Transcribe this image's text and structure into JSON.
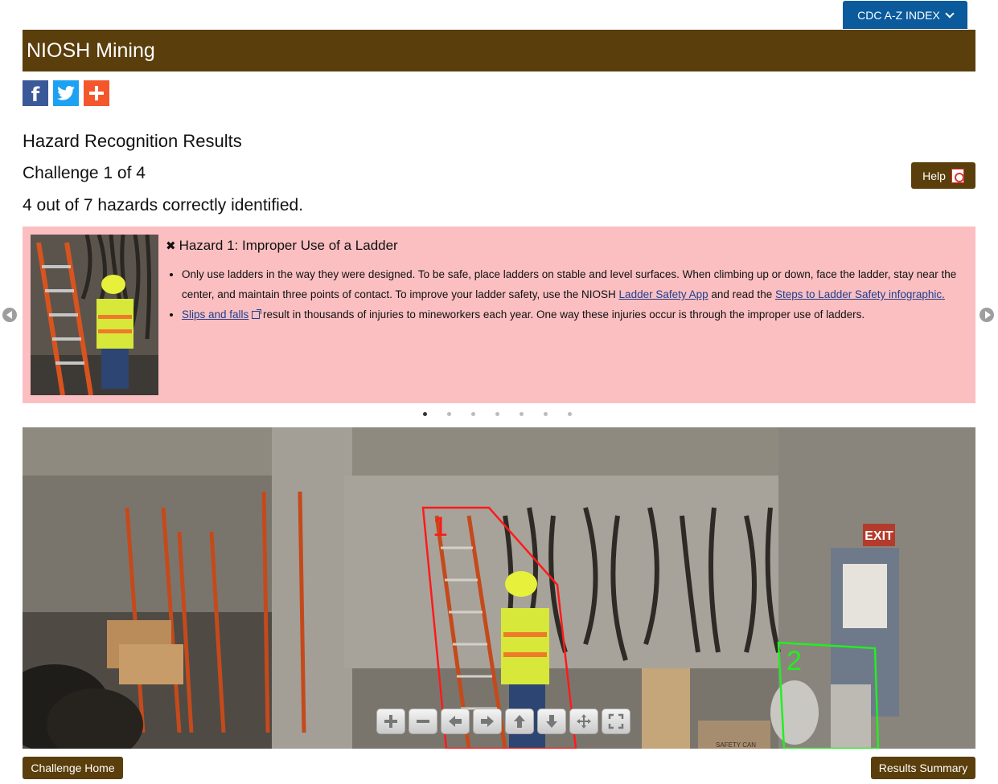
{
  "header": {
    "az_index_label": "CDC A-Z INDEX",
    "banner_title": "NIOSH Mining"
  },
  "social": {
    "facebook_glyph": "f",
    "twitter_icon": "twitter-bird-icon",
    "add_icon": "plus-icon"
  },
  "results": {
    "title": "Hazard Recognition Results",
    "challenge": "Challenge 1 of 4",
    "score": "4 out of 7 hazards correctly identified.",
    "help_label": "Help"
  },
  "hazard": {
    "status_glyph": "✖",
    "title": "Hazard 1: Improper Use of a Ladder",
    "bullet1_text": "Only use ladders in the way they were designed. To be safe, place ladders on stable and level surfaces. When climbing up or down, face the ladder, stay near the center, and maintain three points of contact. To improve your ladder safety, use the NIOSH ",
    "bullet1_link1": "Ladder Safety App",
    "bullet1_mid": " and read the ",
    "bullet1_link2": "Steps to Ladder Safety infographic.",
    "bullet2_link": "Slips and falls",
    "bullet2_text": " result in thousands of injuries to mineworkers each year. One way these injuries occur is through the improper use of ladders.",
    "card_color": "#fbbfc1"
  },
  "carousel": {
    "dot_count": 7,
    "active_index": 0
  },
  "scene": {
    "marker1": "1",
    "marker2": "2",
    "exit_sign": "EXIT",
    "box_label": "SAFETY CAN"
  },
  "zoom_controls": [
    "zoom-in-icon",
    "zoom-out-icon",
    "pan-left-icon",
    "pan-right-icon",
    "pan-up-icon",
    "pan-down-icon",
    "reset-icon",
    "fullscreen-icon"
  ],
  "footer": {
    "home_label": "Challenge Home",
    "summary_label": "Results Summary"
  }
}
